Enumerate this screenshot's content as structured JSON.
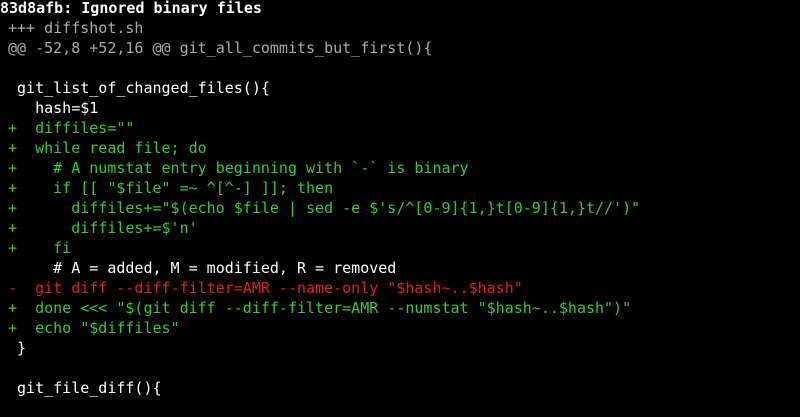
{
  "terminal": {
    "title": "83d8afb: Ignored binary files",
    "lines": [
      {
        "kind": "header",
        "text": "+++ diffshot.sh"
      },
      {
        "kind": "header",
        "text": "@@ -52,8 +52,16 @@ git_all_commits_but_first(){"
      },
      {
        "kind": "context",
        "text": ""
      },
      {
        "kind": "context",
        "text": " git_list_of_changed_files(){"
      },
      {
        "kind": "context",
        "text": "   hash=$1"
      },
      {
        "kind": "add",
        "text": "+  diffiles=\"\""
      },
      {
        "kind": "add",
        "text": "+  while read file; do"
      },
      {
        "kind": "add",
        "text": "+    # A numstat entry beginning with `-` is binary"
      },
      {
        "kind": "add",
        "text": "+    if [[ \"$file\" =~ ^[^-] ]]; then"
      },
      {
        "kind": "add",
        "text": "+      diffiles+=\"$(echo $file | sed -e $'s/^[0-9]{1,}t[0-9]{1,}t//')\""
      },
      {
        "kind": "add",
        "text": "+      diffiles+=$'n'"
      },
      {
        "kind": "add",
        "text": "+    fi"
      },
      {
        "kind": "context",
        "text": "     # A = added, M = modified, R = removed"
      },
      {
        "kind": "del",
        "text": "-  git diff --diff-filter=AMR --name-only \"$hash~..$hash\""
      },
      {
        "kind": "add",
        "text": "+  done <<< \"$(git diff --diff-filter=AMR --numstat \"$hash~..$hash\")\""
      },
      {
        "kind": "add",
        "text": "+  echo \"$diffiles\""
      },
      {
        "kind": "context",
        "text": " }"
      },
      {
        "kind": "context",
        "text": ""
      },
      {
        "kind": "context",
        "text": " git_file_diff(){"
      }
    ]
  },
  "colors": {
    "background": "#000000",
    "header": "#aaaaaa",
    "context": "#ffffff",
    "add": "#33cc33",
    "del": "#e02020"
  }
}
